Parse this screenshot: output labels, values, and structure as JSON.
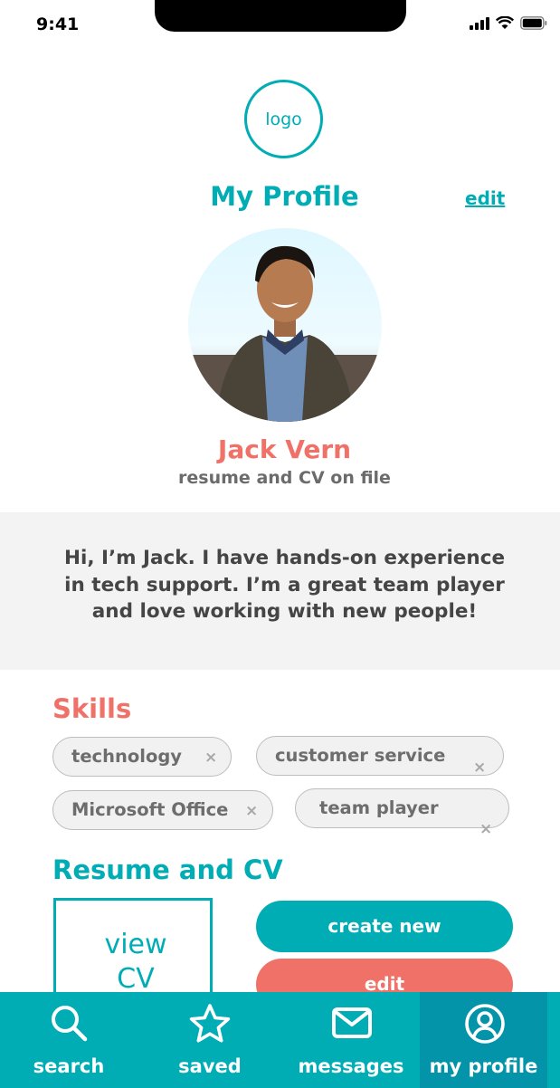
{
  "status": {
    "time": "9:41"
  },
  "logo": {
    "label": "logo"
  },
  "header": {
    "title": "My Profile",
    "edit_label": "edit"
  },
  "user": {
    "name": "Jack Vern",
    "subtitle": "resume and CV on file"
  },
  "bio": "Hi, I’m Jack. I have hands-on experience in tech support. I’m a great team player and love working with new people!",
  "skills": {
    "title": "Skills",
    "items": [
      {
        "label": "technology"
      },
      {
        "label": "customer service"
      },
      {
        "label": "Microsoft Office"
      },
      {
        "label": "team player"
      }
    ],
    "remove_glyph": "×"
  },
  "resume": {
    "title": "Resume and CV",
    "view_label_line1": "view",
    "view_label_line2": "CV",
    "create_label": "create new",
    "edit_label": "edit"
  },
  "nav": {
    "items": [
      {
        "label": "search",
        "icon": "search-icon"
      },
      {
        "label": "saved",
        "icon": "star-icon"
      },
      {
        "label": "messages",
        "icon": "mail-icon"
      },
      {
        "label": "my profile",
        "icon": "user-circle-icon",
        "active": true
      }
    ]
  },
  "colors": {
    "teal": "#00adb5",
    "coral": "#f07167",
    "active_tab": "#0394a9",
    "bio_bg": "#f3f3f3"
  }
}
